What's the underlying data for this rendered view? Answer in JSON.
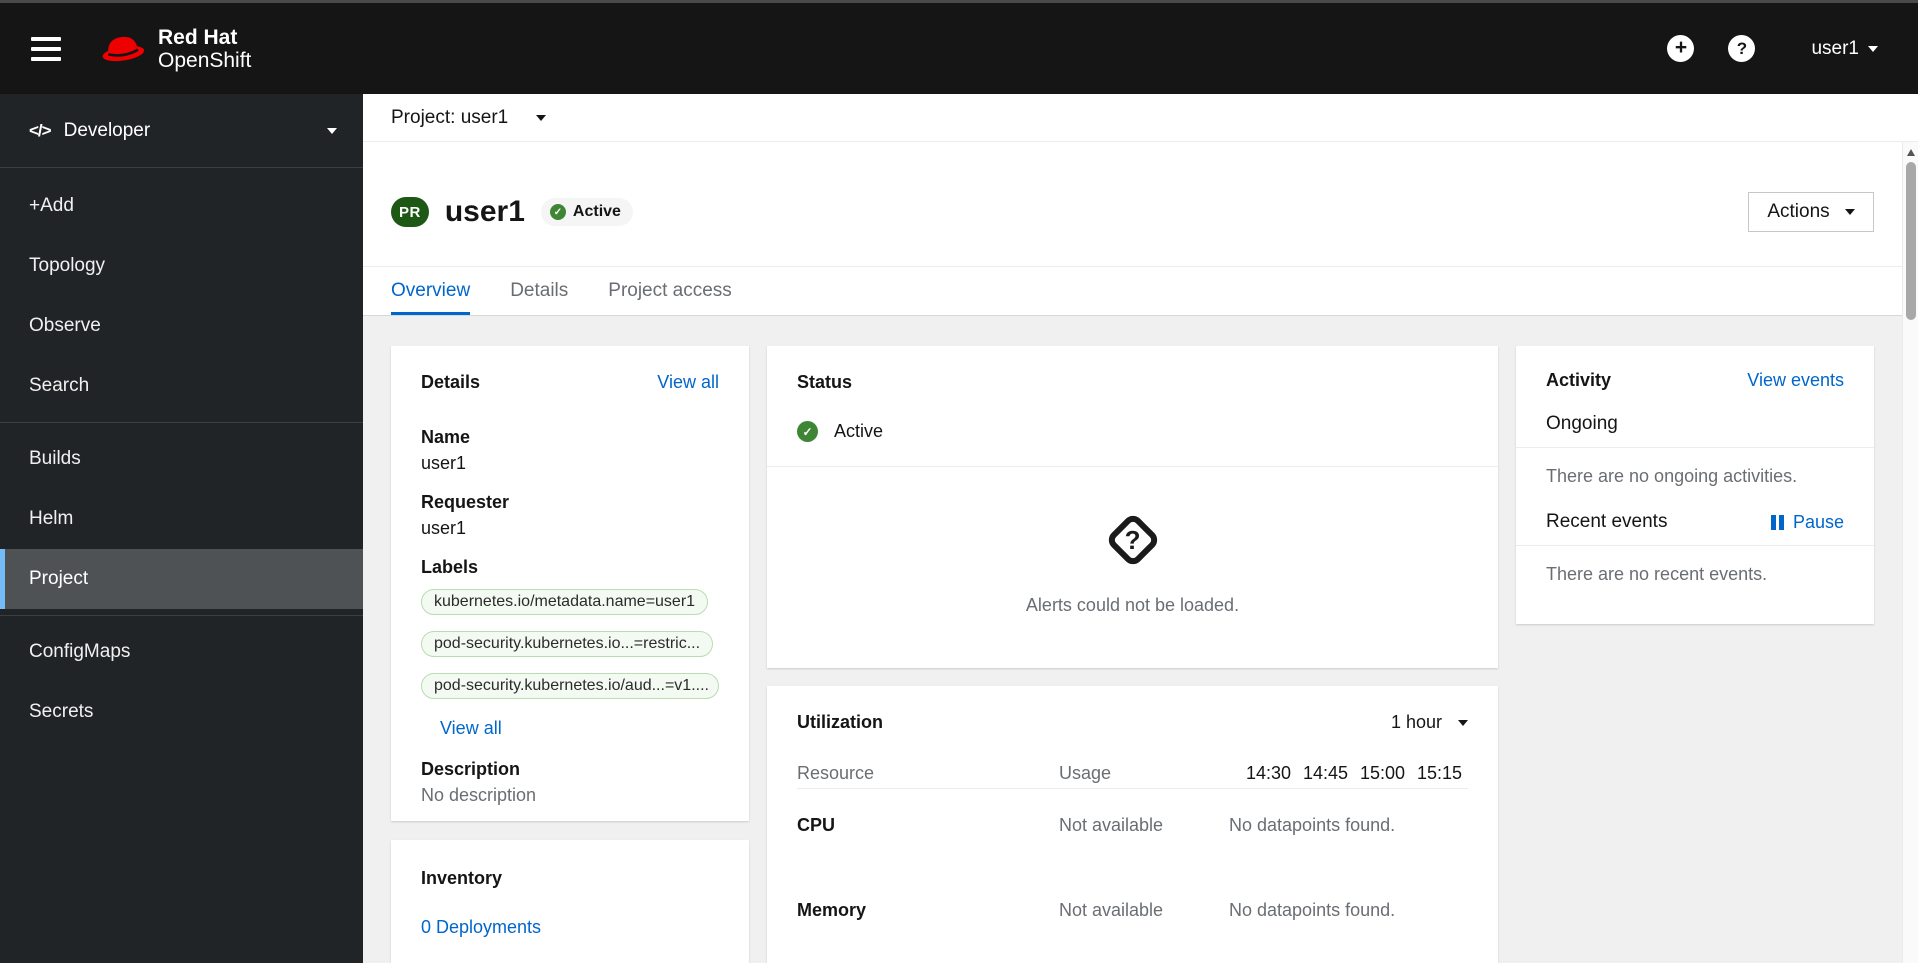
{
  "masthead": {
    "brand_line1": "Red Hat",
    "brand_line2": "OpenShift",
    "username": "user1"
  },
  "icons": {
    "plus": "+",
    "help": "?",
    "check": "✓",
    "question": "?",
    "code": "</>"
  },
  "sidebar": {
    "perspective": "Developer",
    "items": [
      {
        "label": "+Add"
      },
      {
        "label": "Topology"
      },
      {
        "label": "Observe"
      },
      {
        "label": "Search"
      },
      {
        "label": "Builds"
      },
      {
        "label": "Helm"
      },
      {
        "label": "Project"
      },
      {
        "label": "ConfigMaps"
      },
      {
        "label": "Secrets"
      }
    ]
  },
  "project_bar": {
    "label": "Project: user1"
  },
  "page_header": {
    "badge": "PR",
    "title": "user1",
    "status_label": "Active",
    "actions_label": "Actions"
  },
  "tabs": [
    {
      "label": "Overview"
    },
    {
      "label": "Details"
    },
    {
      "label": "Project access"
    }
  ],
  "details_card": {
    "title": "Details",
    "view_all_link": "View all",
    "name_term": "Name",
    "name_value": "user1",
    "requester_term": "Requester",
    "requester_value": "user1",
    "labels_term": "Labels",
    "labels": [
      "kubernetes.io/metadata.name=user1",
      "pod-security.kubernetes.io...=restric...",
      "pod-security.kubernetes.io/aud...=v1...."
    ],
    "labels_view_all_link": "View all",
    "description_term": "Description",
    "description_value": "No description"
  },
  "status_card": {
    "title": "Status",
    "status_label": "Active",
    "alerts_empty_message": "Alerts could not be loaded."
  },
  "utilization_card": {
    "title": "Utilization",
    "duration": "1 hour",
    "resource_column": "Resource",
    "usage_column": "Usage",
    "times": [
      "14:30",
      "14:45",
      "15:00",
      "15:15"
    ],
    "rows": [
      {
        "resource": "CPU",
        "usage": "Not available",
        "datapoints": "No datapoints found."
      },
      {
        "resource": "Memory",
        "usage": "Not available",
        "datapoints": "No datapoints found."
      }
    ]
  },
  "activity_card": {
    "title": "Activity",
    "view_events_link": "View events",
    "ongoing_title": "Ongoing",
    "ongoing_empty": "There are no ongoing activities.",
    "recent_title": "Recent events",
    "pause_label": "Pause",
    "recent_empty": "There are no recent events."
  },
  "inventory_card": {
    "title": "Inventory",
    "deployments_link": "0 Deployments"
  },
  "colors": {
    "accent_blue": "#0066cc",
    "success_green": "#3e8635",
    "project_badge_green": "#1d5915",
    "nav_selected_indicator": "#73bcf7",
    "masthead_bg": "#151515",
    "sidebar_bg": "#212427",
    "content_bg": "#f0f0f0",
    "label_bg": "#f3faf2",
    "label_border": "#b9dcb2",
    "muted_text": "#6a6e73"
  }
}
